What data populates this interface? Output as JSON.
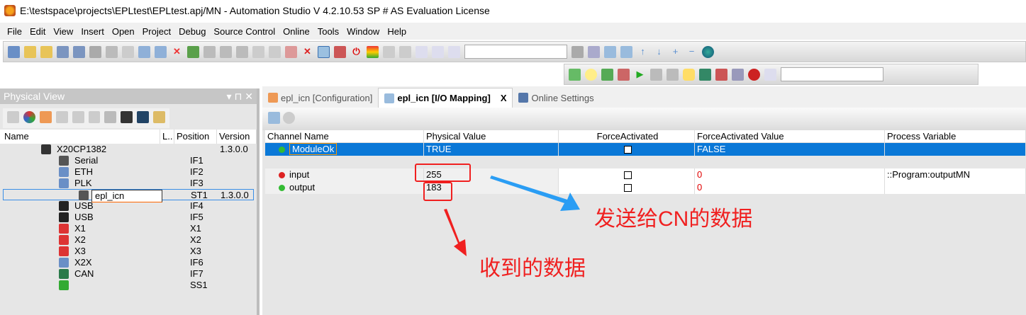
{
  "window": {
    "title": "E:\\testspace\\projects\\EPLtest\\EPLtest.apj/MN - Automation Studio V 4.2.10.53 SP # AS Evaluation License"
  },
  "menu": [
    "File",
    "Edit",
    "View",
    "Insert",
    "Open",
    "Project",
    "Debug",
    "Source Control",
    "Online",
    "Tools",
    "Window",
    "Help"
  ],
  "physical_view": {
    "title": "Physical View",
    "columns": [
      "Name",
      "L..",
      "Position",
      "Version"
    ],
    "rows": [
      {
        "name": "X20CP1382",
        "position": "",
        "version": "1.3.0.0"
      },
      {
        "name": "Serial",
        "position": "IF1",
        "version": ""
      },
      {
        "name": "ETH",
        "position": "IF2",
        "version": ""
      },
      {
        "name": "PLK",
        "position": "IF3",
        "version": ""
      },
      {
        "name": "epl_icn",
        "position": "ST1",
        "version": "1.3.0.0"
      },
      {
        "name": "USB",
        "position": "IF4",
        "version": ""
      },
      {
        "name": "USB",
        "position": "IF5",
        "version": ""
      },
      {
        "name": "X1",
        "position": "X1",
        "version": ""
      },
      {
        "name": "X2",
        "position": "X2",
        "version": ""
      },
      {
        "name": "X3",
        "position": "X3",
        "version": ""
      },
      {
        "name": "X2X",
        "position": "IF6",
        "version": ""
      },
      {
        "name": "CAN",
        "position": "IF7",
        "version": ""
      },
      {
        "name": "",
        "position": "SS1",
        "version": ""
      }
    ]
  },
  "tabs": [
    {
      "label": "epl_icn [Configuration]"
    },
    {
      "label": "epl_icn [I/O Mapping]",
      "close": "X"
    },
    {
      "label": "Online Settings"
    }
  ],
  "io_mapping": {
    "columns": [
      "Channel Name",
      "Physical Value",
      "ForceActivated",
      "ForceActivated Value",
      "Process Variable"
    ],
    "rows": [
      {
        "channel": "ModuleOk",
        "value": "TRUE",
        "force_value": "FALSE",
        "pv": ""
      },
      {
        "channel": "input",
        "value": "255",
        "force_value": "0",
        "pv": "::Program:outputMN"
      },
      {
        "channel": "output",
        "value": "183",
        "force_value": "0",
        "pv": ""
      }
    ]
  },
  "annotations": {
    "sent": "发送给CN的数据",
    "received": "收到的数据"
  },
  "colors": {
    "selection": "#0a78d7",
    "annotation": "#f02020",
    "arrow": "#2a9df4"
  }
}
